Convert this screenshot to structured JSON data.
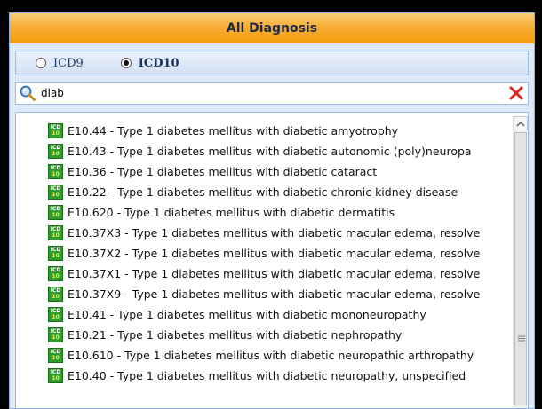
{
  "panel": {
    "title": "All Diagnosis"
  },
  "code_system": {
    "options": [
      {
        "label": "ICD9",
        "selected": false
      },
      {
        "label": "ICD10",
        "selected": true
      }
    ]
  },
  "search": {
    "value": "diab",
    "search_icon": "search-icon",
    "clear_icon": "close-icon"
  },
  "results": [
    {
      "text": "E10.44 - Type 1 diabetes mellitus with diabetic amyotrophy"
    },
    {
      "text": "E10.43 - Type 1 diabetes mellitus with diabetic autonomic (poly)neuropa"
    },
    {
      "text": "E10.36 - Type 1 diabetes mellitus with diabetic cataract"
    },
    {
      "text": "E10.22 - Type 1 diabetes mellitus with diabetic chronic kidney disease"
    },
    {
      "text": "E10.620 - Type 1 diabetes mellitus with diabetic dermatitis"
    },
    {
      "text": "E10.37X3 - Type 1 diabetes mellitus with diabetic macular edema, resolve"
    },
    {
      "text": "E10.37X2 - Type 1 diabetes mellitus with diabetic macular edema, resolve"
    },
    {
      "text": "E10.37X1 - Type 1 diabetes mellitus with diabetic macular edema, resolve"
    },
    {
      "text": "E10.37X9 - Type 1 diabetes mellitus with diabetic macular edema, resolve"
    },
    {
      "text": "E10.41 - Type 1 diabetes mellitus with diabetic mononeuropathy"
    },
    {
      "text": "E10.21 - Type 1 diabetes mellitus with diabetic nephropathy"
    },
    {
      "text": "E10.610 - Type 1 diabetes mellitus with diabetic neuropathic arthropathy"
    },
    {
      "text": "E10.40 - Type 1 diabetes mellitus with diabetic neuropathy, unspecified"
    }
  ],
  "item_icon": {
    "name": "icd10-code-icon",
    "line1": "ICD",
    "line2": "10"
  },
  "colors": {
    "header_orange": "#f6ae36",
    "panel_blue": "#dfe8f6",
    "icon_green": "#2f9d2a",
    "clear_red": "#e02020"
  }
}
